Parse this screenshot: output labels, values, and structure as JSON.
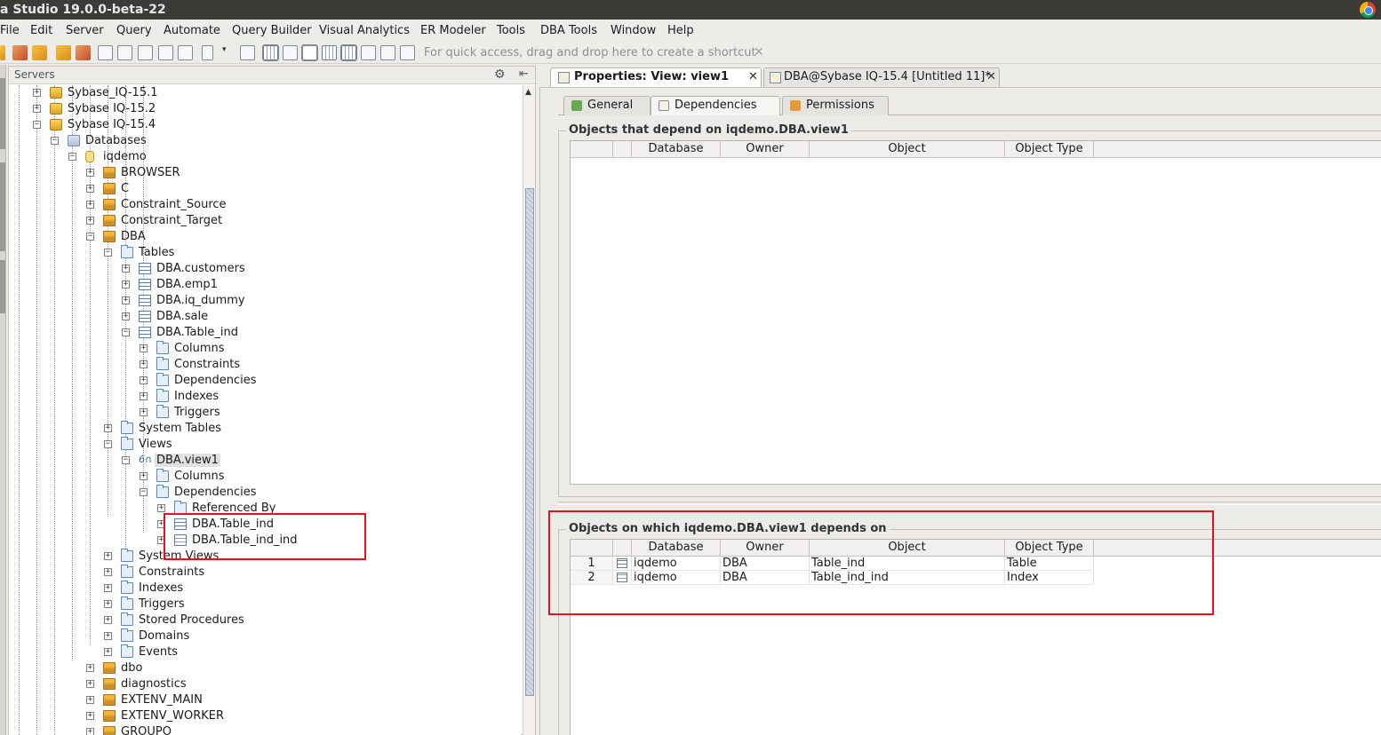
{
  "window": {
    "title": "a Studio 19.0.0-beta-22"
  },
  "menu": [
    "File",
    "Edit",
    "Server",
    "Query",
    "Automate",
    "Query Builder",
    "Visual Analytics",
    "ER Modeler",
    "Tools",
    "DBA Tools",
    "Window",
    "Help"
  ],
  "toolbar": {
    "quick_access_placeholder": "For quick access, drag and drop here to create a shortcut",
    "close_glyph": "✕"
  },
  "servers_panel": {
    "title": "Servers",
    "gear": "⚙",
    "collapse": "⇤"
  },
  "tree": [
    {
      "label": "Sybase_IQ-15.1",
      "icon": "server-icon",
      "exp": "+"
    },
    {
      "label": "Sybase IQ-15.2",
      "icon": "server-icon",
      "exp": "+"
    },
    {
      "label": "Sybase IQ-15.4",
      "icon": "server-icon",
      "exp": "−"
    },
    {
      "label": "Databases",
      "icon": "databases-icon",
      "exp": "−"
    },
    {
      "label": "iqdemo",
      "icon": "database-icon",
      "exp": "−"
    },
    {
      "label": "BROWSER",
      "icon": "owner-icon",
      "exp": "+"
    },
    {
      "label": "C",
      "icon": "owner-icon",
      "exp": "+"
    },
    {
      "label": "Constraint_Source",
      "icon": "owner-icon",
      "exp": "+"
    },
    {
      "label": "Constraint_Target",
      "icon": "owner-icon",
      "exp": "+"
    },
    {
      "label": "DBA",
      "icon": "owner-icon",
      "exp": "−"
    },
    {
      "label": "Tables",
      "icon": "folder-icon",
      "exp": "−"
    },
    {
      "label": "DBA.customers",
      "icon": "table-icon",
      "exp": "+"
    },
    {
      "label": "DBA.emp1",
      "icon": "table-icon",
      "exp": "+"
    },
    {
      "label": "DBA.iq_dummy",
      "icon": "table-icon",
      "exp": "+"
    },
    {
      "label": "DBA.sale",
      "icon": "table-icon",
      "exp": "+"
    },
    {
      "label": "DBA.Table_ind",
      "icon": "table-icon",
      "exp": "−"
    },
    {
      "label": "Columns",
      "icon": "folder-icon",
      "exp": "+"
    },
    {
      "label": "Constraints",
      "icon": "folder-icon",
      "exp": "+"
    },
    {
      "label": "Dependencies",
      "icon": "folder-icon",
      "exp": "+"
    },
    {
      "label": "Indexes",
      "icon": "folder-icon",
      "exp": "+"
    },
    {
      "label": "Triggers",
      "icon": "folder-icon",
      "exp": "+"
    },
    {
      "label": "System Tables",
      "icon": "folder-icon",
      "exp": "+"
    },
    {
      "label": "Views",
      "icon": "folder-icon",
      "exp": "−"
    },
    {
      "label": "DBA.view1",
      "icon": "view-icon",
      "exp": "−"
    },
    {
      "label": "Columns",
      "icon": "folder-icon",
      "exp": "+"
    },
    {
      "label": "Dependencies",
      "icon": "folder-icon",
      "exp": "−"
    },
    {
      "label": "Referenced By",
      "icon": "folder-icon",
      "exp": "+"
    },
    {
      "label": "DBA.Table_ind",
      "icon": "table-icon",
      "exp": "+"
    },
    {
      "label": "DBA.Table_ind_ind",
      "icon": "index-icon",
      "exp": "+"
    },
    {
      "label": "System Views",
      "icon": "folder-icon",
      "exp": "+"
    },
    {
      "label": "Constraints",
      "icon": "folder-icon",
      "exp": "+"
    },
    {
      "label": "Indexes",
      "icon": "folder-icon",
      "exp": "+"
    },
    {
      "label": "Triggers",
      "icon": "folder-icon",
      "exp": "+"
    },
    {
      "label": "Stored Procedures",
      "icon": "folder-icon",
      "exp": "+"
    },
    {
      "label": "Domains",
      "icon": "folder-icon",
      "exp": "+"
    },
    {
      "label": "Events",
      "icon": "folder-icon",
      "exp": "+"
    },
    {
      "label": "dbo",
      "icon": "owner-icon",
      "exp": "+"
    },
    {
      "label": "diagnostics",
      "icon": "owner-icon",
      "exp": "+"
    },
    {
      "label": "EXTENV_MAIN",
      "icon": "owner-icon",
      "exp": "+"
    },
    {
      "label": "EXTENV_WORKER",
      "icon": "owner-icon",
      "exp": "+"
    },
    {
      "label": "GROUPO",
      "icon": "owner-icon",
      "exp": "+"
    }
  ],
  "editor_tabs": [
    {
      "label": "Properties: View: view1",
      "close": "✕"
    },
    {
      "label": "DBA@Sybase IQ-15.4 [Untitled 11]*",
      "close": "✕"
    }
  ],
  "sub_tabs": [
    "General",
    "Dependencies",
    "Permissions"
  ],
  "dependents": {
    "title": "Objects that depend on iqdemo.DBA.view1",
    "columns": [
      "Database",
      "Owner",
      "Object",
      "Object Type"
    ],
    "rows": []
  },
  "depends_on": {
    "title": "Objects on which iqdemo.DBA.view1 depends on",
    "columns": [
      "Database",
      "Owner",
      "Object",
      "Object Type"
    ],
    "rows": [
      {
        "num": "1",
        "database": "iqdemo",
        "owner": "DBA",
        "object": "Table_ind",
        "type": "Table"
      },
      {
        "num": "2",
        "database": "iqdemo",
        "owner": "DBA",
        "object": "Table_ind_ind",
        "type": "Index"
      }
    ]
  },
  "colors": {
    "highlight_box": "#e0141e",
    "titlebar": "#3c3b37"
  }
}
